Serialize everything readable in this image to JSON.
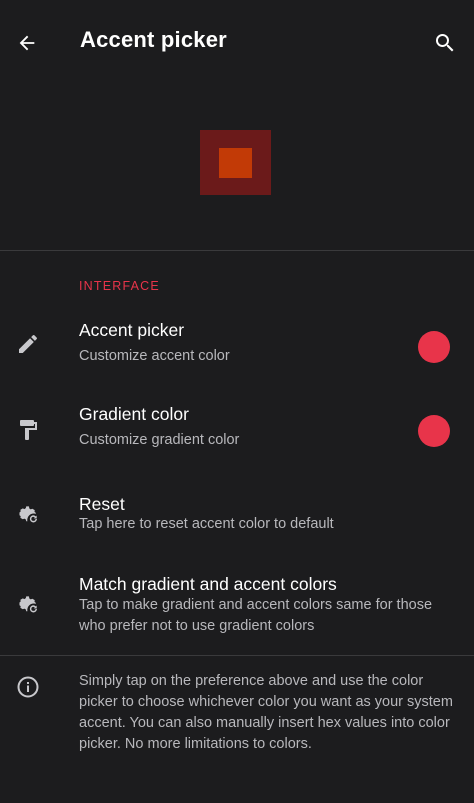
{
  "colors": {
    "background": "#1c1c1e",
    "accent": "#e8344a",
    "preview_outer": "#6b1a1a",
    "preview_inner": "#c23a06",
    "icon": "#c8c8cc",
    "summary_text": "#b8b8bc"
  },
  "appbar": {
    "title": "Accent picker",
    "back_icon": "arrow-back-icon",
    "search_icon": "search-icon"
  },
  "section": {
    "header": "INTERFACE"
  },
  "preferences": [
    {
      "icon": "pencil-icon",
      "title": "Accent picker",
      "summary": "Customize accent color",
      "swatch_color": "#e8344a"
    },
    {
      "icon": "paint-roller-icon",
      "title": "Gradient color",
      "summary": "Customize gradient color",
      "swatch_color": "#e8344a"
    },
    {
      "icon": "settings-reset-icon",
      "title": "Reset",
      "summary": "Tap here to reset accent color to default"
    },
    {
      "icon": "settings-reset-icon",
      "title": "Match gradient and accent colors",
      "summary": "Tap to make gradient and accent colors same for those who prefer not to use gradient colors"
    }
  ],
  "info": {
    "icon": "info-icon",
    "text": "Simply tap on the preference above and use the color picker to choose whichever color you want as your system accent. You can also manually insert hex values into color picker. No more limitations to colors."
  }
}
